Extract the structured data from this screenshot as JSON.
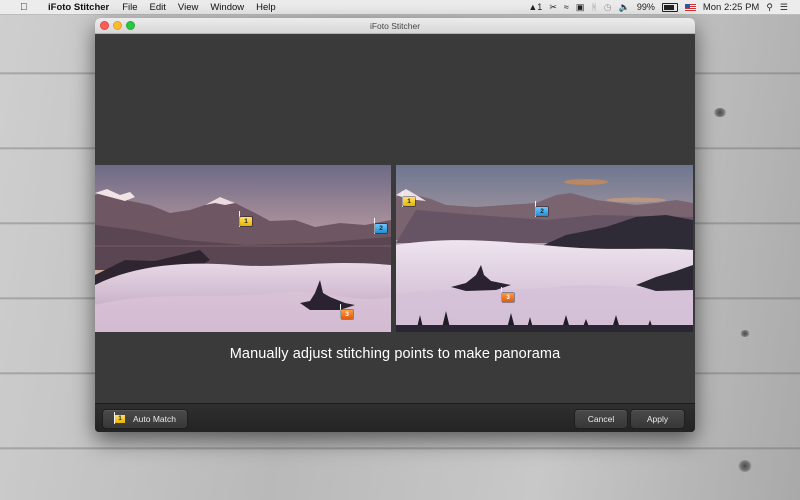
{
  "menubar": {
    "apple_icon": "apple-icon",
    "app_name": "iFoto Stitcher",
    "menus": [
      "File",
      "Edit",
      "View",
      "Window",
      "Help"
    ],
    "status": {
      "adobe_count": "1",
      "battery_percent": "99%",
      "clock": "Mon 2:25 PM"
    }
  },
  "window": {
    "title": "iFoto Stitcher",
    "instruction": "Manually adjust stitching points to make panorama",
    "markers": {
      "one": "1",
      "two": "2",
      "three": "3"
    },
    "buttons": {
      "auto_match": "Auto Match",
      "cancel": "Cancel",
      "apply": "Apply"
    }
  },
  "colors": {
    "marker_1": "#e6b400",
    "marker_2": "#1e8fd8",
    "marker_3": "#e05a10"
  }
}
